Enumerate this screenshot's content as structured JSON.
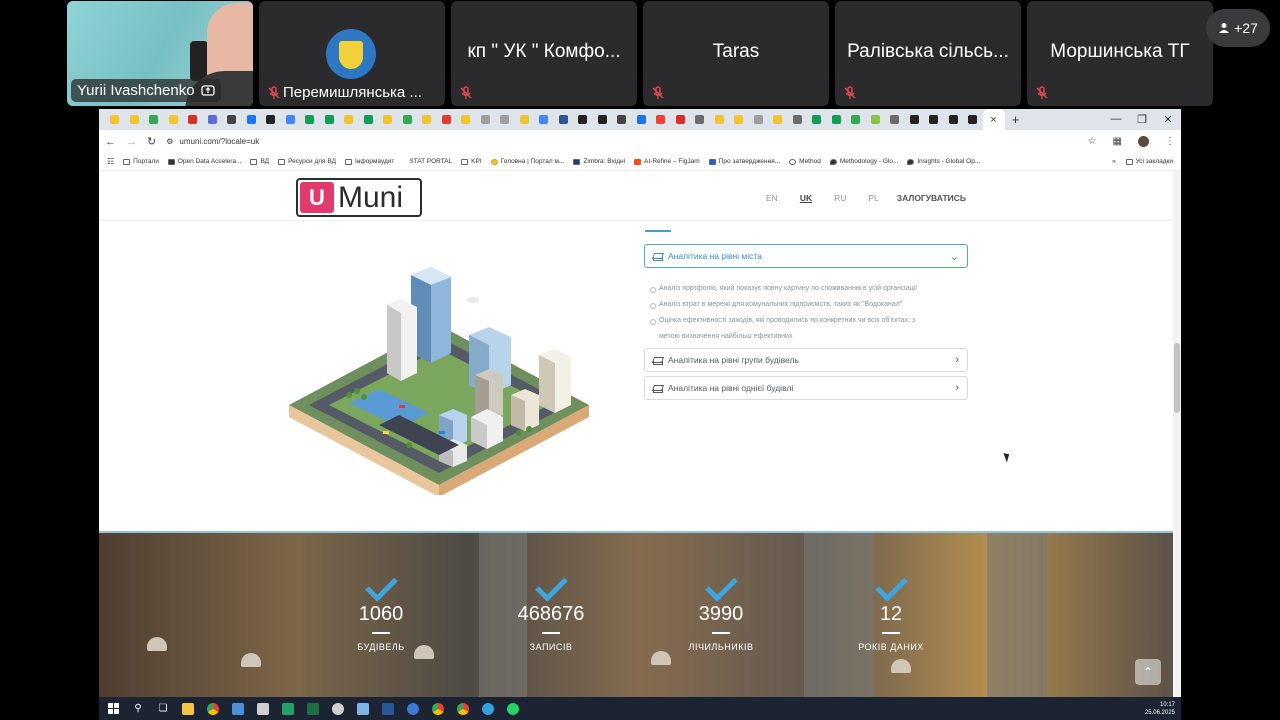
{
  "meeting": {
    "tiles": [
      {
        "name": "Yurii Ivashchenko",
        "type": "video"
      },
      {
        "name": "Перемишлянська ...",
        "type": "avatar"
      },
      {
        "name": "кп \" УК \" Комфо...",
        "type": "name"
      },
      {
        "name": "Taras",
        "type": "name"
      },
      {
        "name": "Ралівська сільсь...",
        "type": "name"
      },
      {
        "name": "Моршинська ТГ",
        "type": "name"
      }
    ],
    "more_participants": "+27"
  },
  "browser": {
    "tab_close": "×",
    "new_tab": "+",
    "url": "umuni.com/?locale=uk",
    "bookmarks": [
      "Портали",
      "Open Data Accelera...",
      "ВД",
      "Ресурси для ВД",
      "Інформаудит",
      "STAT PORTAL",
      "KPI",
      "Головна | Портал м...",
      "Zimbra: Вхідні",
      "AI-Refine – FigJam",
      "Про затвердження...",
      "Method",
      "Methodology - Glo...",
      "Insights - Global Op..."
    ],
    "bookmarks_more": "»",
    "all_bookmarks": "Усі закладки"
  },
  "site": {
    "logo_u": "U",
    "logo_text": "Muni",
    "langs": [
      "EN",
      "UK",
      "RU",
      "PL"
    ],
    "active_lang": "UK",
    "login": "ЗАЛОГУВАТИСЬ",
    "accordion": [
      {
        "title": "Аналітика на рівні міста",
        "open": true
      },
      {
        "title": "Аналітика на рівні групи будівель",
        "open": false
      },
      {
        "title": "Аналітика на рівні однієї будівлі",
        "open": false
      }
    ],
    "city_items": [
      "Аналіз портфоліо, який показує повну картину по споживанню в усій організації",
      "Аналіз втрат в мережі для комунальних підприємств, таких як \"Водоканал\"",
      "Оцінка ефективності заходів, які проводились по конкретних чи всіх об'єктах, з",
      "метою визначення найбільш ефективних"
    ],
    "stats": [
      {
        "value": "1060",
        "label": "БУДІВЕЛЬ"
      },
      {
        "value": "468676",
        "label": "ЗАПИСІВ"
      },
      {
        "value": "3990",
        "label": "ЛІЧИЛЬНИКІВ"
      },
      {
        "value": "12",
        "label": "РОКІВ ДАНИХ"
      }
    ],
    "colors": {
      "brand": "#e23a6c",
      "accent": "#3fa5de"
    }
  },
  "taskbar": {
    "time": "10:17",
    "date": "25.06.2025"
  }
}
